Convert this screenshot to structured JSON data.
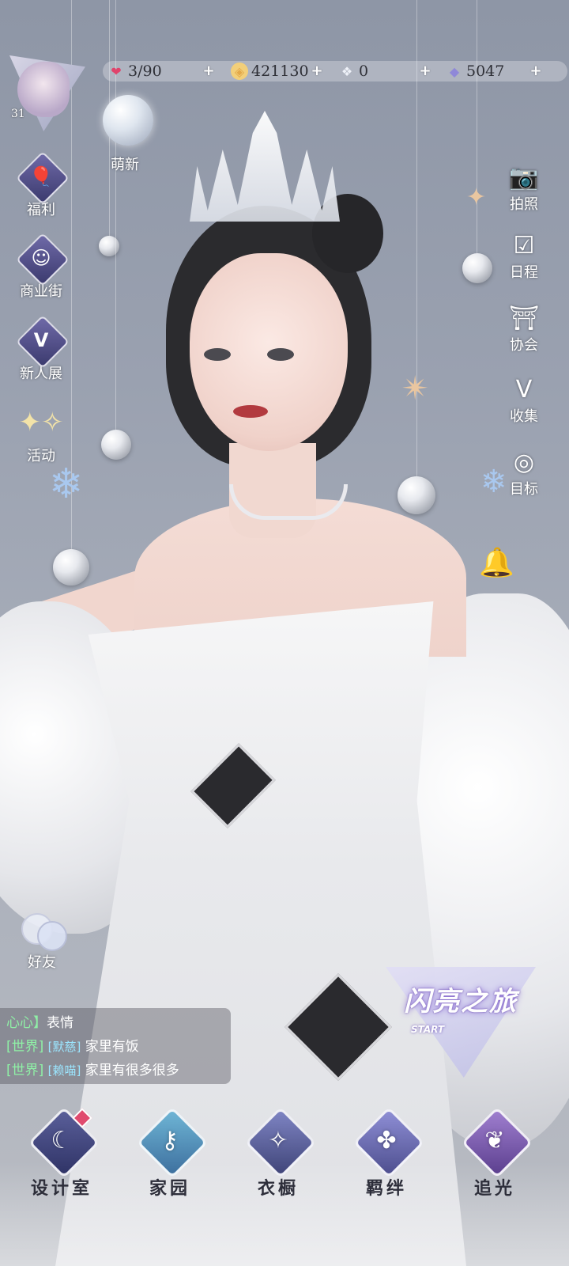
{
  "resources": [
    {
      "icon": "heart-gem-icon",
      "value": "3/90"
    },
    {
      "icon": "gold-coin-icon",
      "value": "421130"
    },
    {
      "icon": "crystal-flower-icon",
      "value": "0"
    },
    {
      "icon": "diamond-icon",
      "value": "5047"
    }
  ],
  "player": {
    "level": "31"
  },
  "newbie": {
    "label": "萌新"
  },
  "left_menu": [
    {
      "icon": "hot-air-balloon-icon",
      "label": "福利"
    },
    {
      "icon": "shopping-bag-icon",
      "label": "商业街"
    },
    {
      "icon": "new-exhibit-icon",
      "label": "新人展"
    },
    {
      "icon": "stars-icon",
      "label": "活动"
    }
  ],
  "right_menu": [
    {
      "icon": "camera-icon",
      "label": "拍照"
    },
    {
      "icon": "calendar-check-icon",
      "label": "日程"
    },
    {
      "icon": "guild-building-icon",
      "label": "协会"
    },
    {
      "icon": "collection-v-icon",
      "label": "收集"
    },
    {
      "icon": "target-medal-icon",
      "label": "目标"
    }
  ],
  "friends": {
    "label": "好友"
  },
  "chat": [
    {
      "channel": "",
      "nick": "",
      "prefix": "心心】",
      "text": "表情"
    },
    {
      "channel": "[世界]",
      "nick": "[默慈]",
      "prefix": "",
      "text": "家里有饭"
    },
    {
      "channel": "[世界]",
      "nick": "[赖喵]",
      "prefix": "",
      "text": "家里有很多很多"
    }
  ],
  "event_banner": {
    "title": "闪亮之旅",
    "subtitle": "START"
  },
  "bottom_nav": [
    {
      "icon": "moon-design-icon",
      "label": "设计室",
      "badge": true
    },
    {
      "icon": "key-home-icon",
      "label": "家园",
      "badge": false
    },
    {
      "icon": "crystal-wardrobe-icon",
      "label": "衣橱",
      "badge": false
    },
    {
      "icon": "clover-bond-icon",
      "label": "羁绊",
      "badge": false
    },
    {
      "icon": "butterfly-light-icon",
      "label": "追光",
      "badge": false
    }
  ],
  "colors": {
    "accent": "#6f6aa8",
    "chat_channel": "#8ff0a6",
    "chat_nick": "#9be6ff"
  }
}
